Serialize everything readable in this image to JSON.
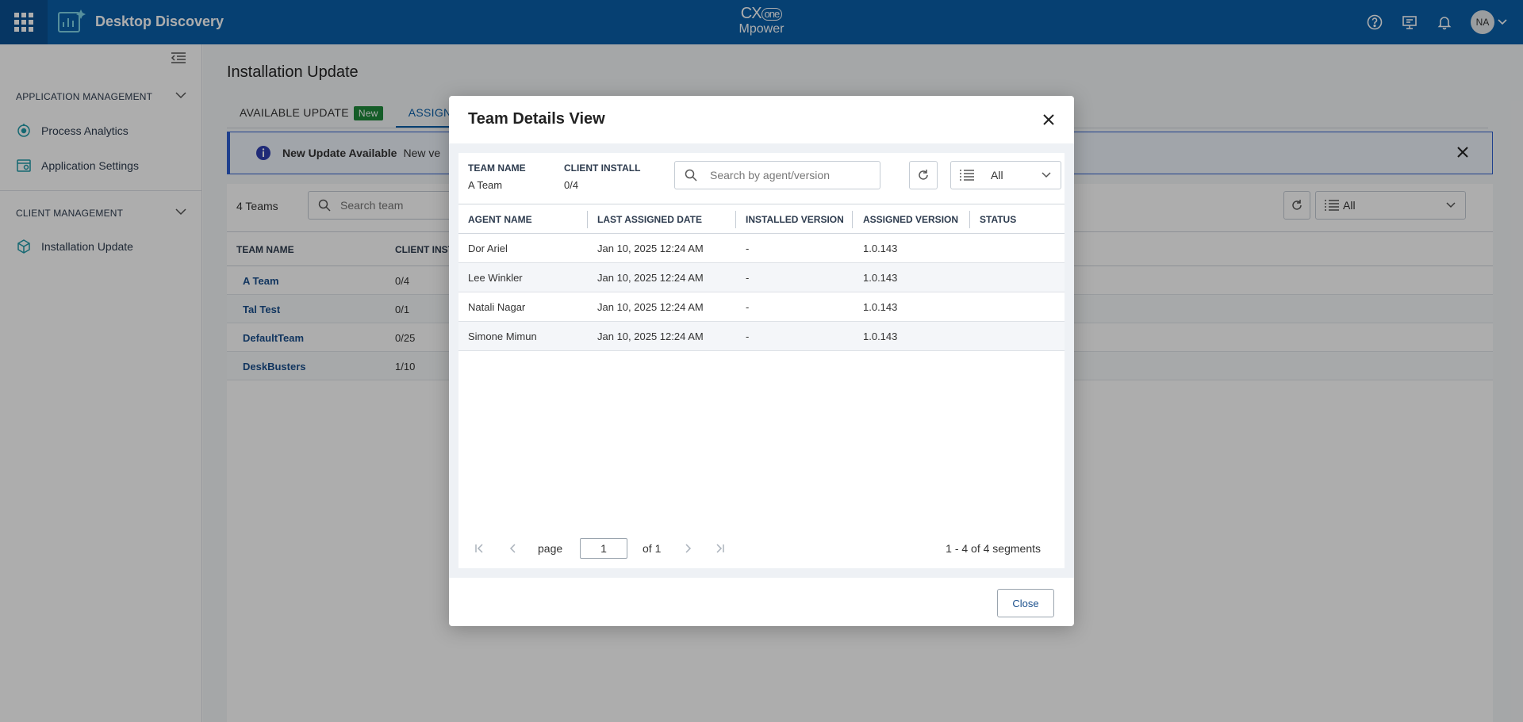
{
  "header": {
    "app_title": "Desktop Discovery",
    "brand_line1_a": "CX",
    "brand_line1_b": "one",
    "brand_line2": "Mpower",
    "avatar_initials": "NA",
    "brand_color": "#0a5fa8"
  },
  "sidebar": {
    "sections": [
      {
        "title": "APPLICATION MANAGEMENT",
        "items": [
          {
            "label": "Process Analytics",
            "icon": "process-analytics-icon"
          },
          {
            "label": "Application Settings",
            "icon": "settings-icon"
          }
        ]
      },
      {
        "title": "CLIENT MANAGEMENT",
        "items": [
          {
            "label": "Installation Update",
            "icon": "installation-update-icon"
          }
        ]
      }
    ]
  },
  "main": {
    "page_title": "Installation Update",
    "tabs": [
      {
        "label": "AVAILABLE UPDATE",
        "badge": "New"
      },
      {
        "label": "ASSIGN"
      }
    ],
    "banner": {
      "title": "New Update Available",
      "text": "New ve"
    },
    "teams_count": "4 Teams",
    "search_placeholder": "Search team",
    "filter_value": "All",
    "table": {
      "headers": [
        "TEAM NAME",
        "CLIENT INST"
      ],
      "rows": [
        {
          "team": "A Team",
          "client": "0/4"
        },
        {
          "team": "Tal Test",
          "client": "0/1"
        },
        {
          "team": "DefaultTeam",
          "client": "0/25"
        },
        {
          "team": "DeskBusters",
          "client": "1/10"
        }
      ]
    }
  },
  "modal": {
    "title": "Team Details View",
    "team_name_label": "TEAM NAME",
    "team_name_value": "A Team",
    "client_install_label": "CLIENT INSTALL",
    "client_install_value": "0/4",
    "search_placeholder": "Search by agent/version",
    "filter_value": "All",
    "columns": [
      "AGENT NAME",
      "LAST ASSIGNED DATE",
      "INSTALLED VERSION",
      "ASSIGNED VERSION",
      "STATUS"
    ],
    "rows": [
      {
        "agent": "Dor Ariel",
        "date": "Jan 10, 2025 12:24 AM",
        "installed": "-",
        "assigned": "1.0.143",
        "status": ""
      },
      {
        "agent": "Lee Winkler",
        "date": "Jan 10, 2025 12:24 AM",
        "installed": "-",
        "assigned": "1.0.143",
        "status": ""
      },
      {
        "agent": "Natali Nagar",
        "date": "Jan 10, 2025 12:24 AM",
        "installed": "-",
        "assigned": "1.0.143",
        "status": ""
      },
      {
        "agent": "Simone Mimun",
        "date": "Jan 10, 2025 12:24 AM",
        "installed": "-",
        "assigned": "1.0.143",
        "status": ""
      }
    ],
    "pager": {
      "page_label": "page",
      "page_value": "1",
      "of_label": "of 1",
      "summary": "1 - 4 of 4 segments"
    },
    "close_label": "Close"
  }
}
